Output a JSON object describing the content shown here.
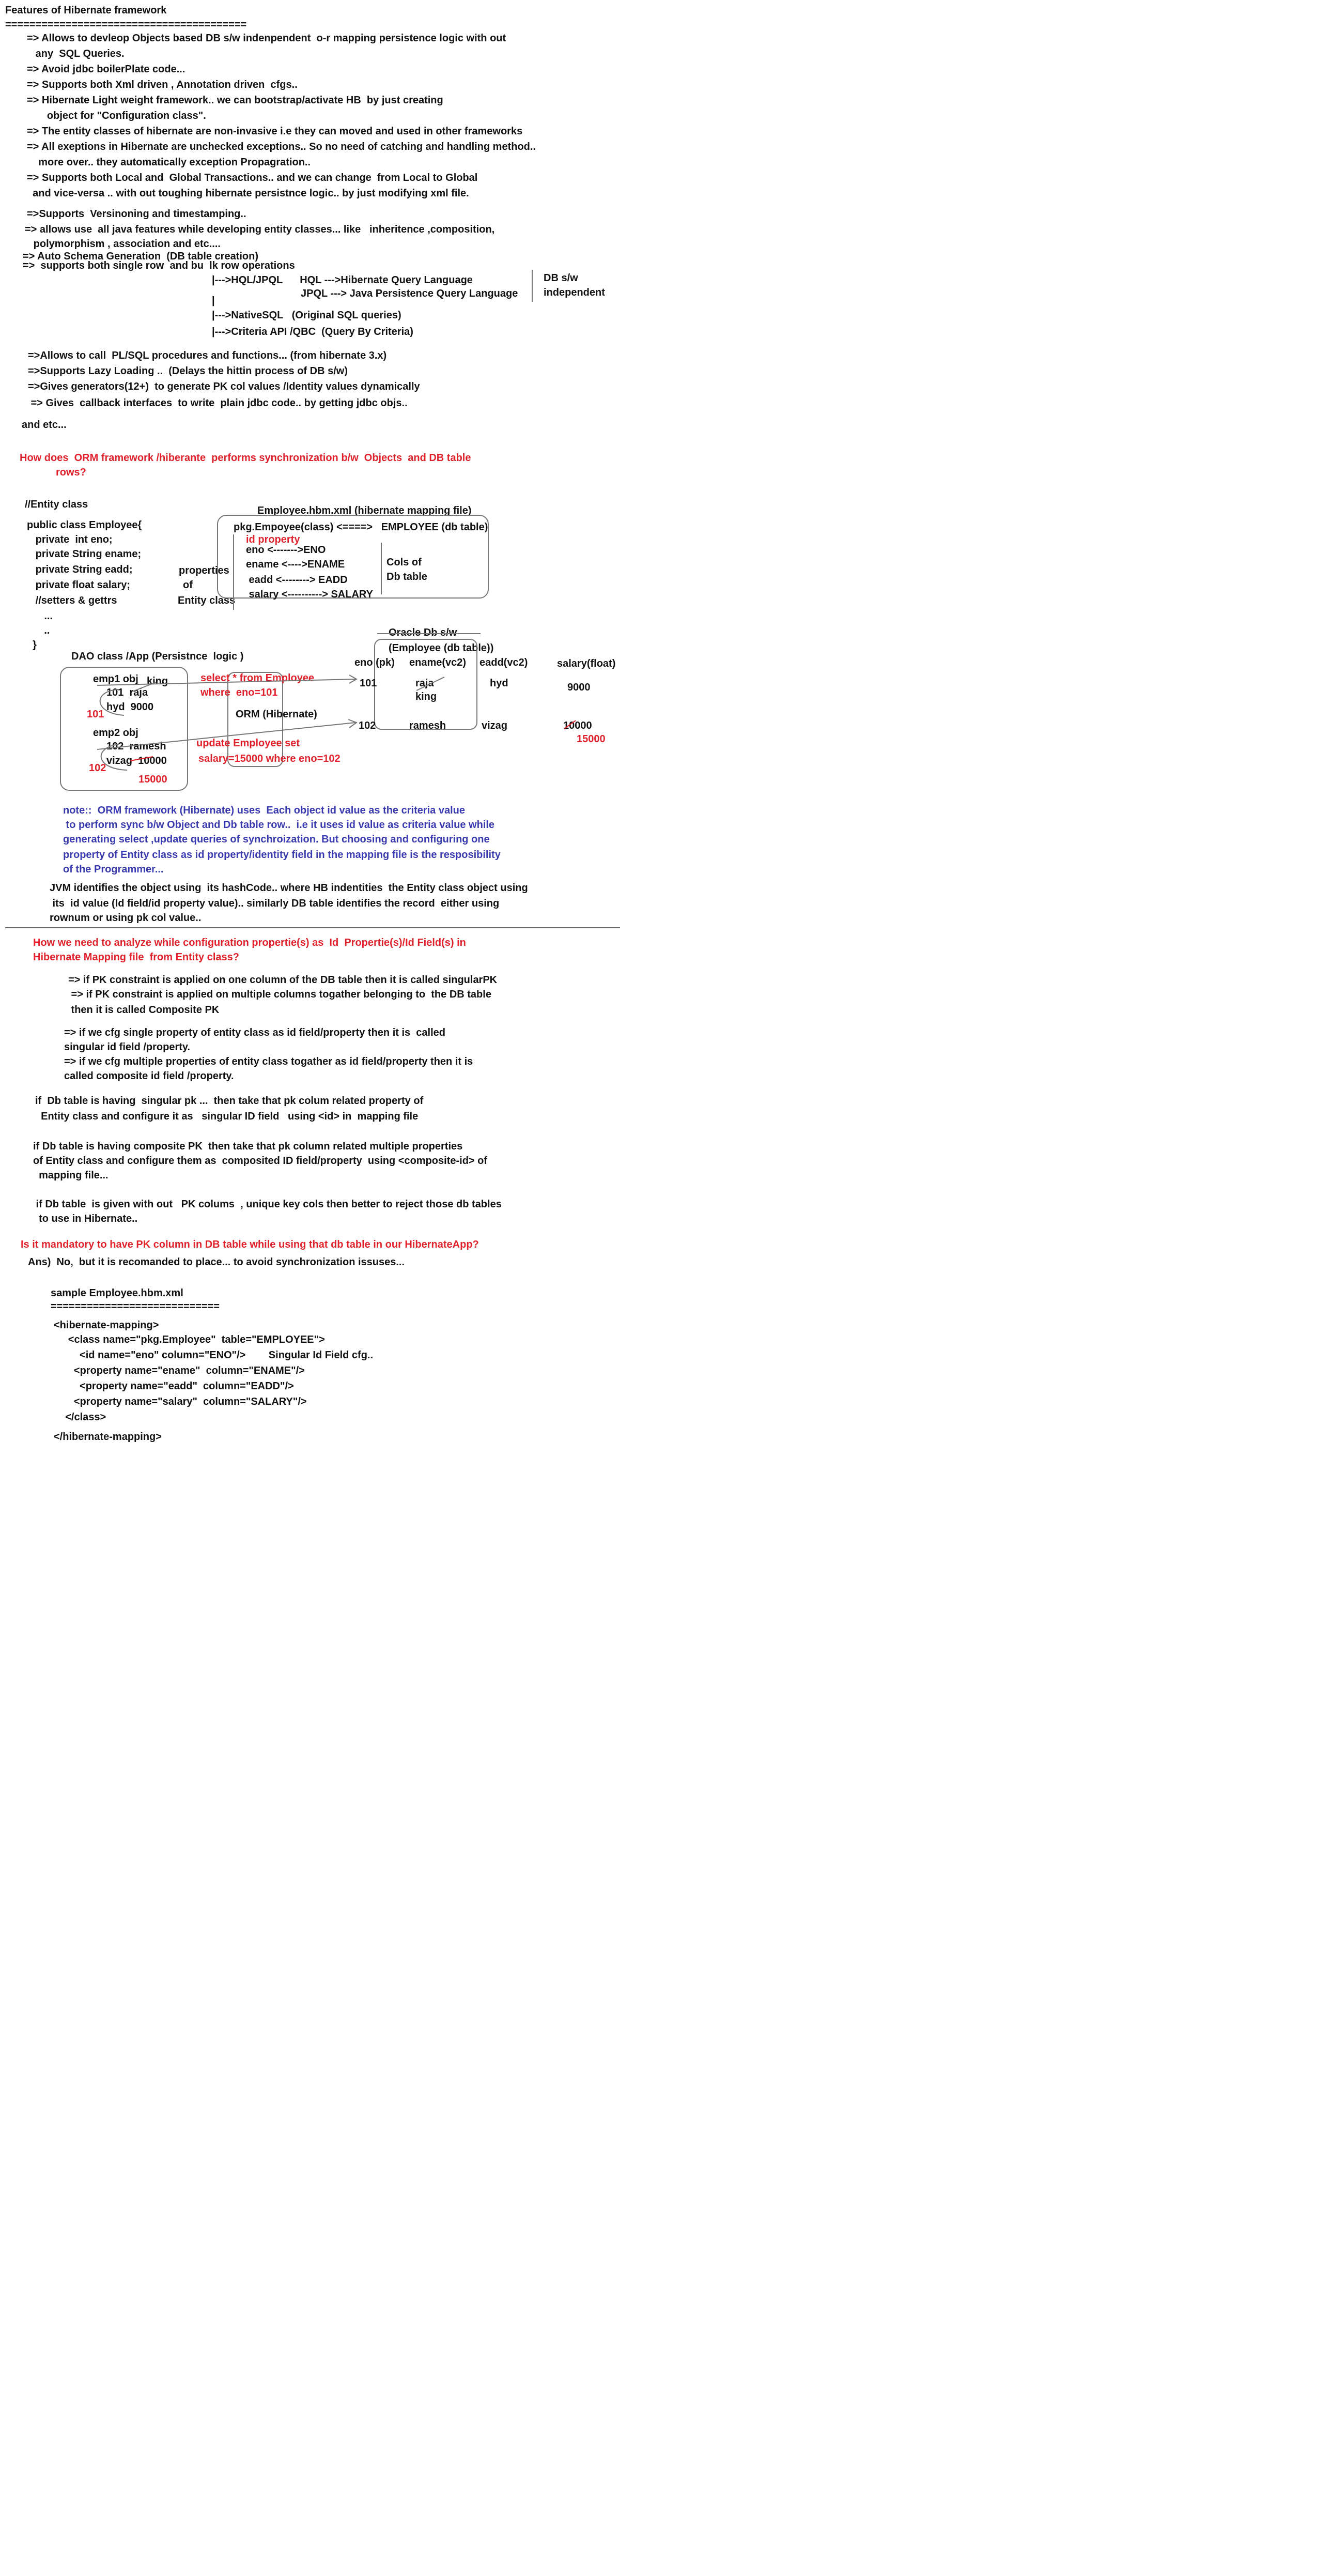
{
  "features": {
    "title": "Features of Hibernate framework",
    "underline": "========================================",
    "lines": [
      "=> Allows to devleop Objects based DB s/w indenpendent  o-r mapping persistence logic with out",
      "   any  SQL Queries.",
      "=> Avoid jdbc boilerPlate code...",
      "=> Supports both Xml driven , Annotation driven  cfgs..",
      "=> Hibernate Light weight framework.. we can bootstrap/activate HB  by just creating",
      "       object for \"Configuration class\".",
      "=> The entity classes of hibernate are non-invasive i.e they can moved and used in other frameworks",
      "=> All exeptions in Hibernate are unchecked exceptions.. So no need of catching and handling method..",
      "    more over.. they automatically exception Propagration..",
      "=> Supports both Local and  Global Transactions.. and we can change  from Local to Global",
      "  and vice-versa .. with out toughing hibernate persistnce logic.. by just modifying xml file."
    ],
    "versioning": "=>Supports  Versinoning and timestamping..",
    "allows_use": "=> allows use  all java features while developing entity classes... like   inheritence ,composition,",
    "allows_use2": "   polymorphism , association and etc....",
    "auto_schema": "=> Auto Schema Generation  (DB table creation)",
    "single_bulk": "=>  supports both single row  and bu  lk row operations",
    "hql": "|--->HQL/JPQL      HQL --->Hibernate Query Language",
    "jpql": "JPQL ---> Java Persistence Query Language",
    "pipe": "|",
    "nativesql": "|--->NativeSQL   (Original SQL queries)",
    "criteria": "|--->Criteria API /QBC  (Query By Criteria)",
    "db_indep1": "DB s/w",
    "db_indep2": "independent",
    "more": [
      "=>Allows to call  PL/SQL procedures and functions... (from hibernate 3.x)",
      "=>Supports Lazy Loading ..  (Delays the hittin process of DB s/w)",
      "=>Gives generators(12+)  to generate PK col values /Identity values dynamically",
      " => Gives  callback interfaces  to write  plain jdbc code.. by getting jdbc objs.."
    ],
    "etc": "and etc..."
  },
  "q1": {
    "line1": "How does  ORM framework /hiberante  performs synchronization b/w  Objects  and DB table",
    "line2": "rows?"
  },
  "entity": {
    "comment": "//Entity class",
    "lines": [
      "public class Employee{",
      "   private  int eno;",
      "   private String ename;",
      "   private String eadd;",
      "   private float salary;",
      "   //setters & gettrs",
      "      ...",
      "      ..",
      "  }"
    ],
    "properties_label": "properties",
    "of_label": "of",
    "entity_class_label": "Entity class"
  },
  "mapping": {
    "title": "Employee.hbm.xml (hibernate mapping file)",
    "class_line": "pkg.Empoyee(class) <====>   EMPLOYEE (db table)",
    "id_property": "id property",
    "rows": [
      "eno <------->ENO",
      "ename <---->ENAME",
      " eadd <--------> EADD",
      " salary <----------> SALARY"
    ],
    "cols1": "Cols of",
    "cols2": "Db table"
  },
  "oracle": {
    "title": "Oracle Db s/w",
    "table": "(Employee (db table))",
    "headers": [
      "eno (pk)",
      "ename(vc2)",
      "eadd(vc2)",
      "salary(float)"
    ],
    "row1": [
      "101",
      "raja",
      "hyd",
      "9000"
    ],
    "row1_new": "king",
    "row2": [
      "102",
      "ramesh",
      "vizag",
      "10000"
    ],
    "row2_new": "15000"
  },
  "dao": {
    "title": "DAO class /App (Persistnce  logic )",
    "emp1": "emp1 obj",
    "emp1_king": "king",
    "emp1_vals": "101  raja",
    "emp1_vals2": "hyd  9000",
    "emp1_101": "101",
    "emp2": "emp2 obj",
    "emp2_vals": "102  ramesh",
    "emp2_vals2": "vizag  10000",
    "emp2_102": "102",
    "emp2_15000": "15000",
    "orm": "ORM (Hibernate)",
    "select1": "select * from Employee",
    "select2": "where  eno=101",
    "update1": "update Employee set",
    "update2": "salary=15000 where eno=102"
  },
  "note": {
    "lines": [
      "note::  ORM framework (Hibernate) uses  Each object id value as the criteria value",
      " to perform sync b/w Object and Db table row..  i.e it uses id value as criteria value while",
      "generating select ,update queries of synchroization. But choosing and configuring one",
      "property of Entity class as id property/identity field in the mapping file is the resposibility",
      "of the Programmer..."
    ]
  },
  "jvm": {
    "lines": [
      "JVM identifies the object using  its hashCode.. where HB indentities  the Entity class object using",
      " its  id value (Id field/id property value).. similarly DB table identifies the record  either using",
      "rownum or using pk col value.."
    ]
  },
  "q2": {
    "line1": "How we need to analyze while configuration propertie(s) as  Id  Propertie(s)/Id Field(s) in",
    "line2": "Hibernate Mapping file  from Entity class?"
  },
  "pk": {
    "lines1": [
      "=> if PK constraint is applied on one column of the DB table then it is called singularPK",
      " => if PK constraint is applied on multiple columns togather belonging to  the DB table",
      " then it is called Composite PK"
    ],
    "lines2": [
      "=> if we cfg single property of entity class as id field/property then it is  called",
      "singular id field /property.",
      "=> if we cfg multiple properties of entity class togather as id field/property then it is",
      "called composite id field /property."
    ],
    "singular": [
      "if  Db table is having  singular pk ...  then take that pk colum related property of",
      "  Entity class and configure it as   singular ID field   using <id> in  mapping file"
    ],
    "composite": [
      "if Db table is having composite PK  then take that pk column related multiple properties",
      "of Entity class and configure them as  composited ID field/property  using <composite-id> of",
      "  mapping file..."
    ],
    "no_pk": [
      " if Db table  is given with out   PK colums  , unique key cols then better to reject those db tables",
      "  to use in Hibernate.."
    ]
  },
  "q3": {
    "question": "Is it mandatory to have PK column in DB table while using that db table in our HibernateApp?",
    "answer": "Ans)  No,  but it is recomanded to place... to avoid synchronization issuses..."
  },
  "sample": {
    "title": "sample Employee.hbm.xml",
    "underline": "============================",
    "lines": [
      "<hibernate-mapping>",
      "     <class name=\"pkg.Employee\"  table=\"EMPLOYEE\">",
      "         <id name=\"eno\" column=\"ENO\"/>        Singular Id Field cfg..",
      "       <property name=\"ename\"  column=\"ENAME\"/>",
      "         <property name=\"eadd\"  column=\"EADD\"/>",
      "       <property name=\"salary\"  column=\"SALARY\"/>",
      "    </class>",
      "</hibernate-mapping>"
    ]
  }
}
